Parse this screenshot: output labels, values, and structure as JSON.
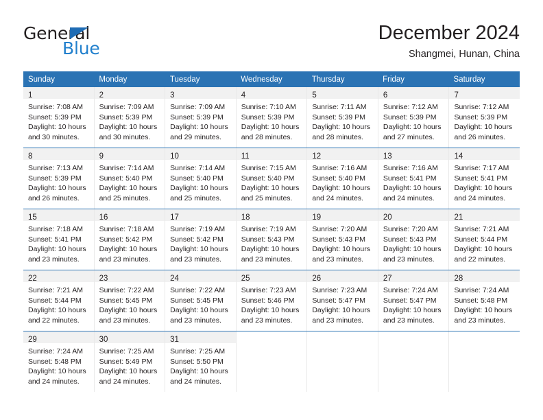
{
  "brand": {
    "name_dark": "General",
    "name_light": "Blue",
    "triangle_color": "#1f6cb4",
    "light_color": "#2280cd"
  },
  "header": {
    "title": "December 2024",
    "subtitle": "Shangmei, Hunan, China",
    "accent_color": "#2b73b4"
  },
  "calendar": {
    "weekdays": [
      "Sunday",
      "Monday",
      "Tuesday",
      "Wednesday",
      "Thursday",
      "Friday",
      "Saturday"
    ],
    "weeks": [
      [
        {
          "day": "1",
          "sunrise": "Sunrise: 7:08 AM",
          "sunset": "Sunset: 5:39 PM",
          "daylight1": "Daylight: 10 hours",
          "daylight2": "and 30 minutes."
        },
        {
          "day": "2",
          "sunrise": "Sunrise: 7:09 AM",
          "sunset": "Sunset: 5:39 PM",
          "daylight1": "Daylight: 10 hours",
          "daylight2": "and 30 minutes."
        },
        {
          "day": "3",
          "sunrise": "Sunrise: 7:09 AM",
          "sunset": "Sunset: 5:39 PM",
          "daylight1": "Daylight: 10 hours",
          "daylight2": "and 29 minutes."
        },
        {
          "day": "4",
          "sunrise": "Sunrise: 7:10 AM",
          "sunset": "Sunset: 5:39 PM",
          "daylight1": "Daylight: 10 hours",
          "daylight2": "and 28 minutes."
        },
        {
          "day": "5",
          "sunrise": "Sunrise: 7:11 AM",
          "sunset": "Sunset: 5:39 PM",
          "daylight1": "Daylight: 10 hours",
          "daylight2": "and 28 minutes."
        },
        {
          "day": "6",
          "sunrise": "Sunrise: 7:12 AM",
          "sunset": "Sunset: 5:39 PM",
          "daylight1": "Daylight: 10 hours",
          "daylight2": "and 27 minutes."
        },
        {
          "day": "7",
          "sunrise": "Sunrise: 7:12 AM",
          "sunset": "Sunset: 5:39 PM",
          "daylight1": "Daylight: 10 hours",
          "daylight2": "and 26 minutes."
        }
      ],
      [
        {
          "day": "8",
          "sunrise": "Sunrise: 7:13 AM",
          "sunset": "Sunset: 5:39 PM",
          "daylight1": "Daylight: 10 hours",
          "daylight2": "and 26 minutes."
        },
        {
          "day": "9",
          "sunrise": "Sunrise: 7:14 AM",
          "sunset": "Sunset: 5:40 PM",
          "daylight1": "Daylight: 10 hours",
          "daylight2": "and 25 minutes."
        },
        {
          "day": "10",
          "sunrise": "Sunrise: 7:14 AM",
          "sunset": "Sunset: 5:40 PM",
          "daylight1": "Daylight: 10 hours",
          "daylight2": "and 25 minutes."
        },
        {
          "day": "11",
          "sunrise": "Sunrise: 7:15 AM",
          "sunset": "Sunset: 5:40 PM",
          "daylight1": "Daylight: 10 hours",
          "daylight2": "and 25 minutes."
        },
        {
          "day": "12",
          "sunrise": "Sunrise: 7:16 AM",
          "sunset": "Sunset: 5:40 PM",
          "daylight1": "Daylight: 10 hours",
          "daylight2": "and 24 minutes."
        },
        {
          "day": "13",
          "sunrise": "Sunrise: 7:16 AM",
          "sunset": "Sunset: 5:41 PM",
          "daylight1": "Daylight: 10 hours",
          "daylight2": "and 24 minutes."
        },
        {
          "day": "14",
          "sunrise": "Sunrise: 7:17 AM",
          "sunset": "Sunset: 5:41 PM",
          "daylight1": "Daylight: 10 hours",
          "daylight2": "and 24 minutes."
        }
      ],
      [
        {
          "day": "15",
          "sunrise": "Sunrise: 7:18 AM",
          "sunset": "Sunset: 5:41 PM",
          "daylight1": "Daylight: 10 hours",
          "daylight2": "and 23 minutes."
        },
        {
          "day": "16",
          "sunrise": "Sunrise: 7:18 AM",
          "sunset": "Sunset: 5:42 PM",
          "daylight1": "Daylight: 10 hours",
          "daylight2": "and 23 minutes."
        },
        {
          "day": "17",
          "sunrise": "Sunrise: 7:19 AM",
          "sunset": "Sunset: 5:42 PM",
          "daylight1": "Daylight: 10 hours",
          "daylight2": "and 23 minutes."
        },
        {
          "day": "18",
          "sunrise": "Sunrise: 7:19 AM",
          "sunset": "Sunset: 5:43 PM",
          "daylight1": "Daylight: 10 hours",
          "daylight2": "and 23 minutes."
        },
        {
          "day": "19",
          "sunrise": "Sunrise: 7:20 AM",
          "sunset": "Sunset: 5:43 PM",
          "daylight1": "Daylight: 10 hours",
          "daylight2": "and 23 minutes."
        },
        {
          "day": "20",
          "sunrise": "Sunrise: 7:20 AM",
          "sunset": "Sunset: 5:43 PM",
          "daylight1": "Daylight: 10 hours",
          "daylight2": "and 23 minutes."
        },
        {
          "day": "21",
          "sunrise": "Sunrise: 7:21 AM",
          "sunset": "Sunset: 5:44 PM",
          "daylight1": "Daylight: 10 hours",
          "daylight2": "and 22 minutes."
        }
      ],
      [
        {
          "day": "22",
          "sunrise": "Sunrise: 7:21 AM",
          "sunset": "Sunset: 5:44 PM",
          "daylight1": "Daylight: 10 hours",
          "daylight2": "and 22 minutes."
        },
        {
          "day": "23",
          "sunrise": "Sunrise: 7:22 AM",
          "sunset": "Sunset: 5:45 PM",
          "daylight1": "Daylight: 10 hours",
          "daylight2": "and 23 minutes."
        },
        {
          "day": "24",
          "sunrise": "Sunrise: 7:22 AM",
          "sunset": "Sunset: 5:45 PM",
          "daylight1": "Daylight: 10 hours",
          "daylight2": "and 23 minutes."
        },
        {
          "day": "25",
          "sunrise": "Sunrise: 7:23 AM",
          "sunset": "Sunset: 5:46 PM",
          "daylight1": "Daylight: 10 hours",
          "daylight2": "and 23 minutes."
        },
        {
          "day": "26",
          "sunrise": "Sunrise: 7:23 AM",
          "sunset": "Sunset: 5:47 PM",
          "daylight1": "Daylight: 10 hours",
          "daylight2": "and 23 minutes."
        },
        {
          "day": "27",
          "sunrise": "Sunrise: 7:24 AM",
          "sunset": "Sunset: 5:47 PM",
          "daylight1": "Daylight: 10 hours",
          "daylight2": "and 23 minutes."
        },
        {
          "day": "28",
          "sunrise": "Sunrise: 7:24 AM",
          "sunset": "Sunset: 5:48 PM",
          "daylight1": "Daylight: 10 hours",
          "daylight2": "and 23 minutes."
        }
      ],
      [
        {
          "day": "29",
          "sunrise": "Sunrise: 7:24 AM",
          "sunset": "Sunset: 5:48 PM",
          "daylight1": "Daylight: 10 hours",
          "daylight2": "and 24 minutes."
        },
        {
          "day": "30",
          "sunrise": "Sunrise: 7:25 AM",
          "sunset": "Sunset: 5:49 PM",
          "daylight1": "Daylight: 10 hours",
          "daylight2": "and 24 minutes."
        },
        {
          "day": "31",
          "sunrise": "Sunrise: 7:25 AM",
          "sunset": "Sunset: 5:50 PM",
          "daylight1": "Daylight: 10 hours",
          "daylight2": "and 24 minutes."
        },
        {
          "day": "",
          "sunrise": "",
          "sunset": "",
          "daylight1": "",
          "daylight2": ""
        },
        {
          "day": "",
          "sunrise": "",
          "sunset": "",
          "daylight1": "",
          "daylight2": ""
        },
        {
          "day": "",
          "sunrise": "",
          "sunset": "",
          "daylight1": "",
          "daylight2": ""
        },
        {
          "day": "",
          "sunrise": "",
          "sunset": "",
          "daylight1": "",
          "daylight2": ""
        }
      ]
    ]
  }
}
